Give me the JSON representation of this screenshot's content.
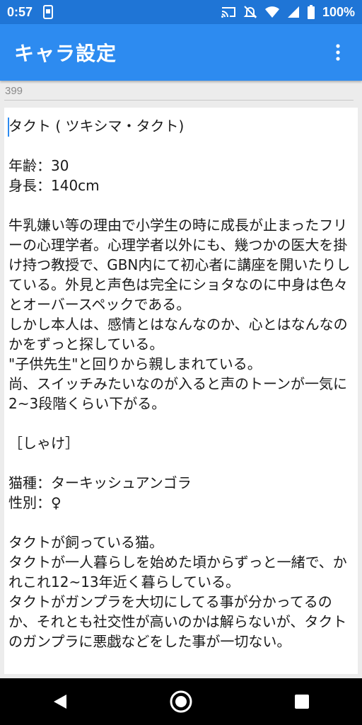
{
  "status": {
    "time": "0:57",
    "battery": "100%"
  },
  "app": {
    "title": "キャラ設定"
  },
  "counter": "399",
  "editor": {
    "content": "タクト ( ツキシマ・タクト)\n\n年齢：30\n身長：140cm\n\n牛乳嫌い等の理由で小学生の時に成長が止まったフリーの心理学者。心理学者以外にも、幾つかの医大を掛け持つ教授で、GBN内にて初心者に講座を開いたりしている。外見と声色は完全にショタなのに中身は色々とオーバースペックである。\nしかし本人は、感情とはなんなのか、心とはなんなのかをずっと探している。\n\"子供先生\"と回りから親しまれている。\n尚、スイッチみたいなのが入ると声のトーンが一気に2~3段階くらい下がる。\n\n［しゃけ］\n\n猫種：ターキッシュアンゴラ\n性別：♀\n\nタクトが飼っている猫。\nタクトが一人暮らしを始めた頃からずっと一緒で、かれこれ12~13年近く暮らしている。\nタクトがガンプラを大切にしてる事が分かってるのか、それとも社交性が高いのかは解らないが、タクトのガンプラに悪戯などをした事が一切ない。"
  },
  "icons": {
    "status_left": [
      "screenshot-icon"
    ],
    "status_right": [
      "cast-icon",
      "mute-icon",
      "wifi-icon",
      "signal-icon",
      "battery-icon"
    ],
    "nav": [
      "back-icon",
      "home-icon",
      "recents-icon"
    ]
  },
  "colors": {
    "status_bar": "#1f75d6",
    "app_bar": "#2d8bf0",
    "background": "#ececec",
    "editor": "#ffffff"
  }
}
